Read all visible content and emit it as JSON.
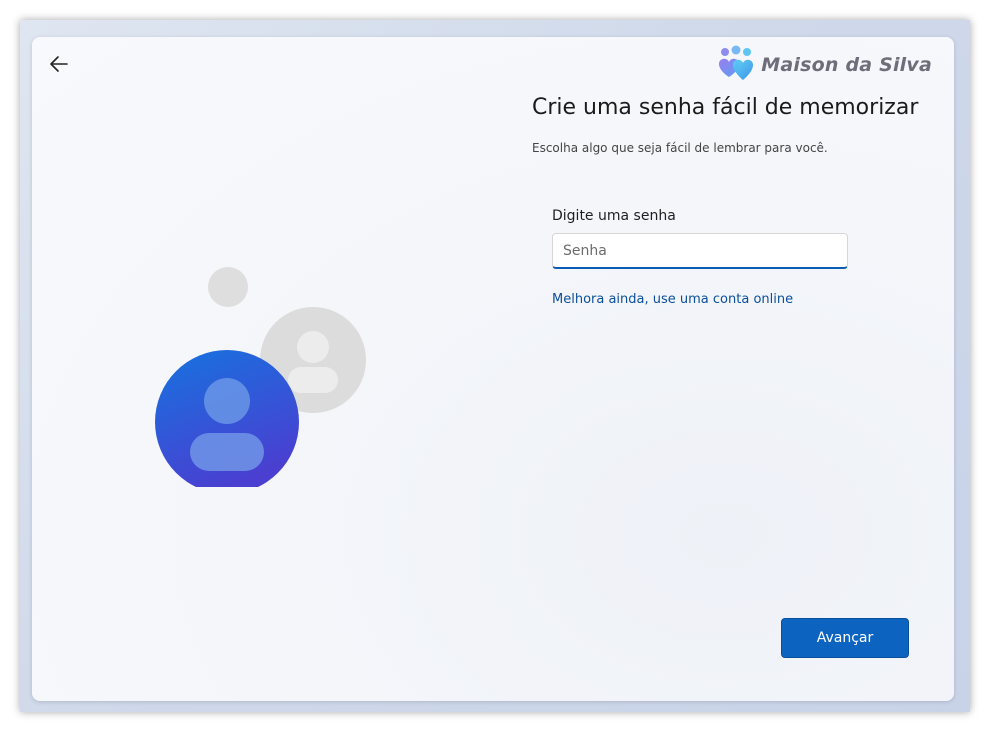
{
  "header": {
    "back_icon": "arrow-left-icon",
    "brand": "Maison da Silva",
    "brand_icon": "hearts-people-logo-icon"
  },
  "main": {
    "title": "Crie uma senha fácil de memorizar",
    "subtitle": "Escolha algo que seja fácil de lembrar para você.",
    "password_label": "Digite uma senha",
    "password_placeholder": "Senha",
    "password_value": "",
    "online_account_link": "Melhora ainda, use uma conta online"
  },
  "footer": {
    "next_label": "Avançar"
  },
  "colors": {
    "accent": "#0d64c0",
    "link": "#0b4f9c",
    "avatar_primary": "#2563d8",
    "avatar_secondary": "#d9d9d9"
  },
  "illustration": {
    "primary_icon": "user-avatar-icon",
    "secondary_icon": "user-avatar-placeholder-icon"
  }
}
